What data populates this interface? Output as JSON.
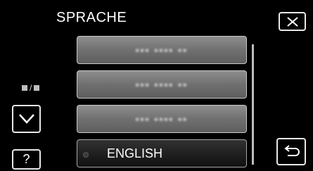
{
  "header": {
    "title": "SPRACHE"
  },
  "icons": {
    "close": "close-x-icon",
    "down": "chevron-down-icon",
    "help": "question-mark-icon",
    "back": "return-arrow-icon"
  },
  "help": {
    "label": "?"
  },
  "list": {
    "items": [
      {
        "label": "▪▪▪ ▪▪▪▪ ▪▪"
      },
      {
        "label": "▪▪▪ ▪▪▪▪ ▪▪"
      },
      {
        "label": "▪▪▪ ▪▪▪▪ ▪▪"
      },
      {
        "label": "ENGLISH"
      }
    ]
  },
  "colors": {
    "background": "#000000",
    "item_gray": "#7a7a7a",
    "item_selected": "#1e1e1e",
    "frame": "#e8e8e8"
  }
}
